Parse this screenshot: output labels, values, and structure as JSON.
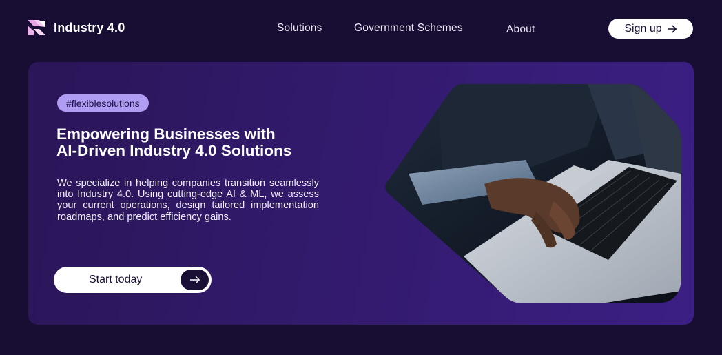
{
  "brand": {
    "name": "Industry 4.0",
    "icon": "logo-mark-icon",
    "accent_color": "#f2a7e6"
  },
  "nav": {
    "items": [
      {
        "label": "Solutions"
      },
      {
        "label": "Government Schemes"
      },
      {
        "label": "About"
      }
    ],
    "signup_label": "Sign up",
    "signup_icon": "arrow-right-icon"
  },
  "hero": {
    "tag": "#flexiblesolutions",
    "headline_line1": "Empowering Businesses with",
    "headline_line2": "AI-Driven Industry 4.0 Solutions",
    "description": "We specialize in helping companies transition seamlessly into Industry 4.0. Using cutting-edge AI & ML, we assess your current operations, design tailored implementation roadmaps, and predict efficiency gains.",
    "cta_label": "Start today",
    "cta_icon": "arrow-right-icon",
    "image_icon": "laptop-typing-photo"
  },
  "colors": {
    "background": "#180d33",
    "card": "#321a6c",
    "tag_bg": "#b19cf4",
    "button_bg": "#ffffff",
    "button_dark": "#1a1036"
  }
}
